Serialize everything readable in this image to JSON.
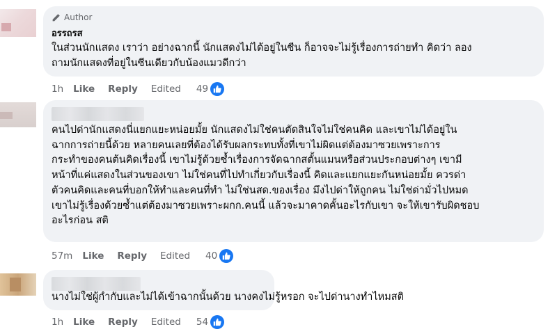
{
  "comments": [
    {
      "author_badge": "Author",
      "name": "อรรถรส",
      "lines": [
        "ในส่วนนักแสดง เราว่า อย่างฉากนี้ นักแสดงไม่ได้อยู่ในซีน ก็อาจจะไม่รู้เรื่องการถ่ายทำ คิดว่า ลอง",
        "ถามนักแสดงที่อยู่ในซีนเดียวกับน้องแมวดีกว่า"
      ],
      "time": "1h",
      "like_label": "Like",
      "reply_label": "Reply",
      "edited_label": "Edited",
      "reaction_count": "49"
    },
    {
      "lines": [
        "คนไปด่านักแสดงนี่แยกแยะหน่อยมั้ย นักแสดงไม่ใช่คนตัดสินใจไม่ใช่คนคิด และเขาไม่ได้อยู่ใน",
        "ฉากการถ่ายนี้ด้วย หลายคนเลยที่ต้องได้รับผลกระทบทั้งที่เขาไม่ผิดแต่ต้องมาซวยเพราะการ",
        "กระทำของคนต้นคิดเรื่องนี้ เขาไม่รู้ด้วยซ้ำเรื่องการจัดฉากสตั้นแมนหรือส่วนประกอบต่างๆ เขามี",
        "หน้าที่แค่แสดงในส่วนของเขา ไม่ใช่คนที่ไปทำเกี่ยวกับเรื่องนี้ คิดและแยกแยะกันหน่อยมั้ย ควรด่า",
        "ตัวคนคิดและคนที่บอกให้ทำและคนที่ทำ ไม่ใช่นสด.ของเรื่อง มึงไปด่าให้ถูกคน ไม่ใช่ด่ามั่วไปหมด",
        "เขาไม่รู้เรื่องด้วยซ้ำแต่ต้องมาซวยเพราะผกก.คนนี้ แล้วจะมาคาดคั้นอะไรกับเขา จะให้เขารับผิดชอบ",
        "อะไรก่อน สติ"
      ],
      "time": "57m",
      "like_label": "Like",
      "reply_label": "Reply",
      "edited_label": "Edited",
      "reaction_count": "40"
    },
    {
      "lines": [
        "นางไม่ใช่ผู้กำกับและไม่ได้เข้าฉากนั้นด้วย นางคงไม่รู้หรอก จะไปด่านางทำไหมสติ"
      ],
      "time": "1h",
      "like_label": "Like",
      "reply_label": "Reply",
      "edited_label": "Edited",
      "reaction_count": "54"
    }
  ],
  "icons": {
    "author_badge": "pencil-icon",
    "reaction": "thumbs-up-icon"
  },
  "colors": {
    "bubble": "#f0f2f5",
    "secondary_text": "#65676b",
    "like_blue": "#1877f2"
  }
}
